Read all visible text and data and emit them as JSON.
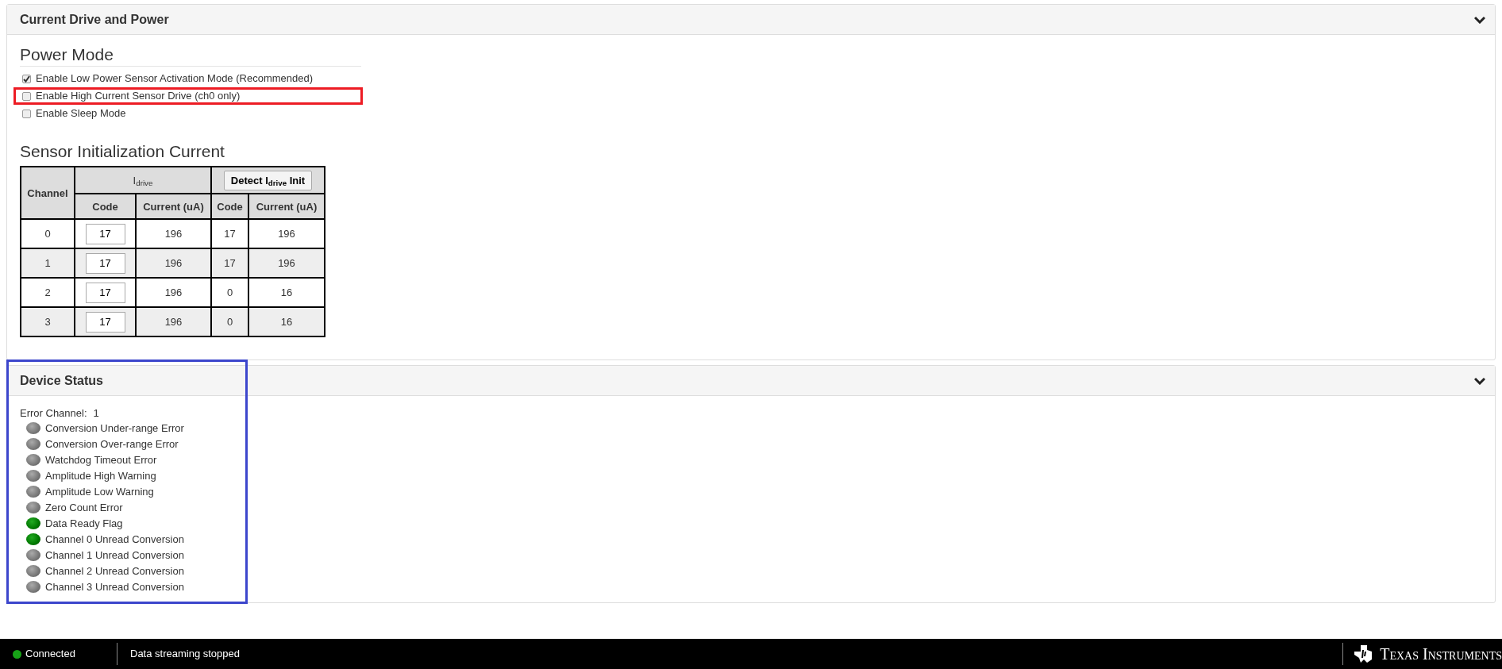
{
  "panels": [
    {
      "title": "Current Drive and Power",
      "expanded": true
    }
  ],
  "power_mode": {
    "heading": "Power Mode",
    "options": [
      {
        "label": "Enable Low Power Sensor Activation Mode (Recommended)",
        "checked": true,
        "highlighted": false
      },
      {
        "label": "Enable High Current Sensor Drive (ch0 only)",
        "checked": false,
        "highlighted": true
      },
      {
        "label": "Enable Sleep Mode",
        "checked": false,
        "highlighted": false
      }
    ]
  },
  "init_current": {
    "heading": "Sensor Initialization Current",
    "columns": {
      "channel": "Channel",
      "idrive": "I$_{drive}$",
      "detect_button": "Detect I$_{drive}$ Init",
      "code": "Code",
      "current": "Current (uA)",
      "code_2": "Code",
      "current_2": "Current (uA)"
    },
    "rows": [
      {
        "channel": "0",
        "code": "17",
        "current": "196",
        "detected_code": "17",
        "detected_current": "196"
      },
      {
        "channel": "1",
        "code": "17",
        "current": "196",
        "detected_code": "17",
        "detected_current": "196"
      },
      {
        "channel": "2",
        "code": "17",
        "current": "196",
        "detected_code": "0",
        "detected_current": "16"
      },
      {
        "channel": "3",
        "code": "17",
        "current": "196",
        "detected_code": "0",
        "detected_current": "16"
      }
    ]
  },
  "device_status": {
    "title": "Device Status",
    "expanded": true,
    "highlighted": true,
    "error_channel_label": "Error Channel:",
    "error_channel": "1",
    "flags": [
      {
        "label": "Conversion Under-range Error",
        "on": false
      },
      {
        "label": "Conversion Over-range Error",
        "on": false
      },
      {
        "label": "Watchdog Timeout Error",
        "on": false
      },
      {
        "label": "Amplitude High Warning",
        "on": false
      },
      {
        "label": "Amplitude Low Warning",
        "on": false
      },
      {
        "label": "Zero Count Error",
        "on": false
      },
      {
        "label": "Data Ready Flag",
        "on": true
      },
      {
        "label": "Channel 0 Unread Conversion",
        "on": true
      },
      {
        "label": "Channel 1 Unread Conversion",
        "on": false
      },
      {
        "label": "Channel 2 Unread Conversion",
        "on": false
      },
      {
        "label": "Channel 3 Unread Conversion",
        "on": false
      }
    ]
  },
  "status_bar": {
    "connected": true,
    "connection": "Connected",
    "streaming": "Data streaming stopped",
    "logo": "Texas Instruments"
  }
}
